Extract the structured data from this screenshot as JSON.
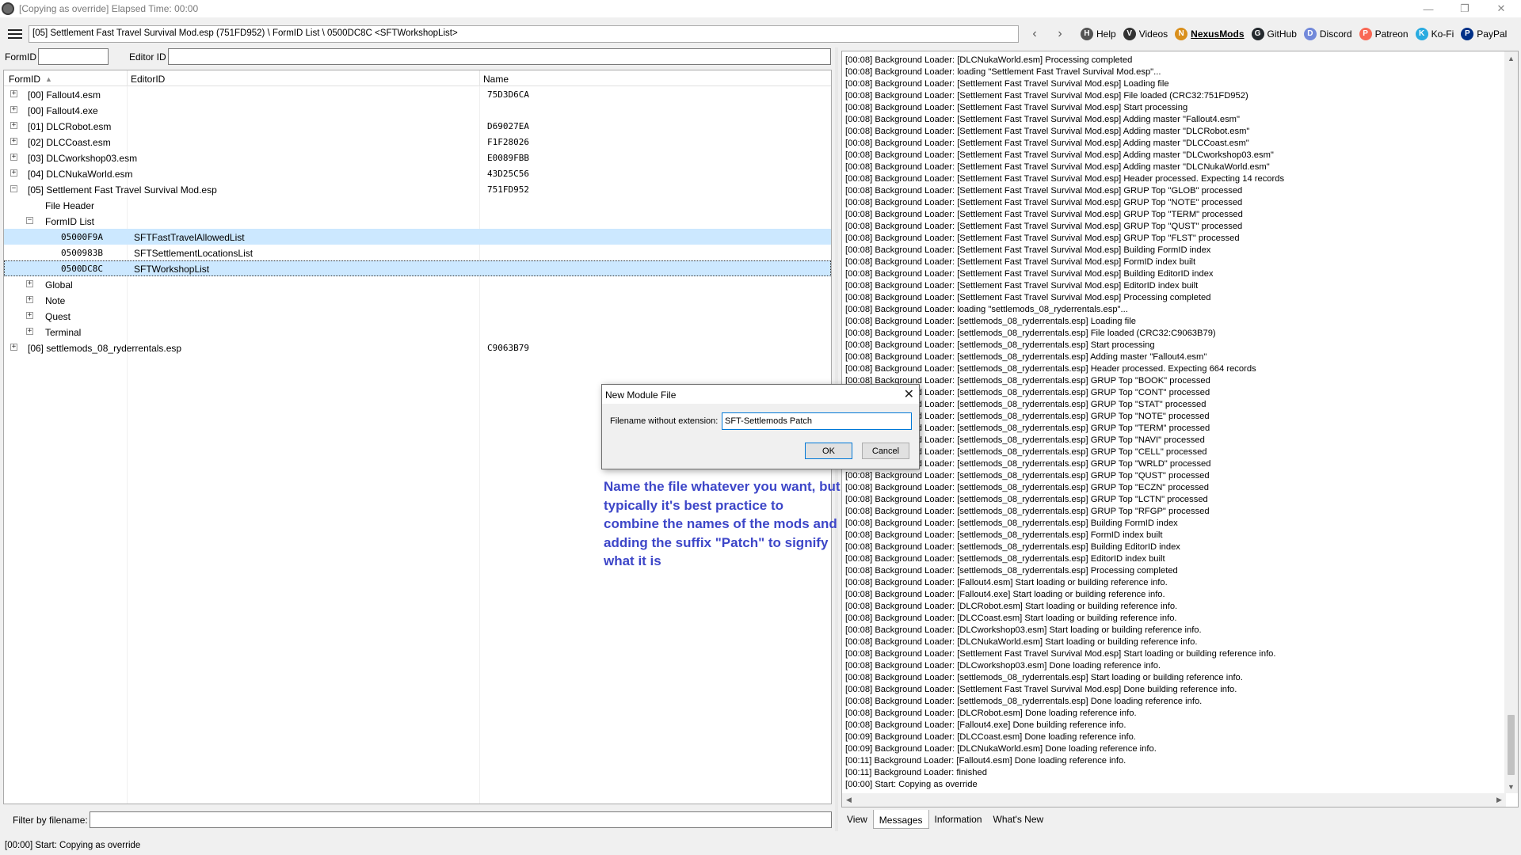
{
  "window": {
    "title": "[Copying as override] Elapsed Time: 00:00",
    "minimize": "—",
    "maximize": "❐",
    "close": "✕"
  },
  "toolbar": {
    "path": "[05] Settlement Fast Travel Survival Mod.esp (751FD952) \\ FormID List \\ 0500DC8C <SFTWorkshopList>",
    "back": "‹",
    "forward": "›",
    "links": [
      {
        "label": "Help",
        "icon": "book-icon",
        "color": "#555555"
      },
      {
        "label": "Videos",
        "icon": "video-icon",
        "color": "#333333"
      },
      {
        "label": "NexusMods",
        "icon": "nexusmods-icon",
        "color": "#d98f1c"
      },
      {
        "label": "GitHub",
        "icon": "github-icon",
        "color": "#24292e"
      },
      {
        "label": "Discord",
        "icon": "discord-icon",
        "color": "#7289da"
      },
      {
        "label": "Patreon",
        "icon": "patreon-icon",
        "color": "#f96854"
      },
      {
        "label": "Ko-Fi",
        "icon": "kofi-icon",
        "color": "#29abe0"
      },
      {
        "label": "PayPal",
        "icon": "paypal-icon",
        "color": "#003087"
      }
    ]
  },
  "filters": {
    "formid_label": "FormID",
    "editorid_label": "Editor ID",
    "filter_by_filename_label": "Filter by filename:"
  },
  "tree": {
    "columns": [
      "FormID",
      "EditorID",
      "Name"
    ],
    "sort_arrow": "▲",
    "rows": [
      {
        "label": "[00] Fallout4.esm",
        "hash": "75D3D6CA",
        "expander": "+"
      },
      {
        "label": "[00] Fallout4.exe",
        "hash": "",
        "expander": "+"
      },
      {
        "label": "[01] DLCRobot.esm",
        "hash": "D69027EA",
        "expander": "+"
      },
      {
        "label": "[02] DLCCoast.esm",
        "hash": "F1F28026",
        "expander": "+"
      },
      {
        "label": "[03] DLCworkshop03.esm",
        "hash": "E0089FBB",
        "expander": "+"
      },
      {
        "label": "[04] DLCNukaWorld.esm",
        "hash": "43D25C56",
        "expander": "+"
      },
      {
        "label": "[05] Settlement Fast Travel Survival Mod.esp",
        "hash": "751FD952",
        "expander": "−"
      },
      {
        "label": "File Header",
        "hash": "",
        "expander": ""
      },
      {
        "label": "FormID List",
        "hash": "",
        "expander": "−"
      },
      {
        "label": "05000F9A",
        "editorid": "SFTFastTravelAllowedList",
        "expander": ""
      },
      {
        "label": "0500983B",
        "editorid": "SFTSettlementLocationsList",
        "expander": ""
      },
      {
        "label": "0500DC8C",
        "editorid": "SFTWorkshopList",
        "expander": ""
      },
      {
        "label": "Global",
        "hash": "",
        "expander": "+"
      },
      {
        "label": "Note",
        "hash": "",
        "expander": "+"
      },
      {
        "label": "Quest",
        "hash": "",
        "expander": "+"
      },
      {
        "label": "Terminal",
        "hash": "",
        "expander": "+"
      },
      {
        "label": "[06] settlemods_08_ryderrentals.esp",
        "hash": "C9063B79",
        "expander": "+"
      }
    ]
  },
  "dialog": {
    "title": "New Module File",
    "close": "✕",
    "field_label": "Filename without extension:",
    "field_value": "SFT-Settlemods Patch",
    "ok": "OK",
    "cancel": "Cancel"
  },
  "annotation": "Name the file whatever you want, but typically it's best practice to combine the names of the mods and adding the suffix \"Patch\" to signify what it is",
  "log": [
    "[00:08] Background Loader: [DLCNukaWorld.esm] Processing completed",
    "[00:08] Background Loader: loading \"Settlement Fast Travel Survival Mod.esp\"...",
    "[00:08] Background Loader: [Settlement Fast Travel Survival Mod.esp] Loading file",
    "[00:08] Background Loader: [Settlement Fast Travel Survival Mod.esp] File loaded (CRC32:751FD952)",
    "[00:08] Background Loader: [Settlement Fast Travel Survival Mod.esp] Start processing",
    "[00:08] Background Loader: [Settlement Fast Travel Survival Mod.esp] Adding master \"Fallout4.esm\"",
    "[00:08] Background Loader: [Settlement Fast Travel Survival Mod.esp] Adding master \"DLCRobot.esm\"",
    "[00:08] Background Loader: [Settlement Fast Travel Survival Mod.esp] Adding master \"DLCCoast.esm\"",
    "[00:08] Background Loader: [Settlement Fast Travel Survival Mod.esp] Adding master \"DLCworkshop03.esm\"",
    "[00:08] Background Loader: [Settlement Fast Travel Survival Mod.esp] Adding master \"DLCNukaWorld.esm\"",
    "[00:08] Background Loader: [Settlement Fast Travel Survival Mod.esp] Header processed. Expecting 14 records",
    "[00:08] Background Loader: [Settlement Fast Travel Survival Mod.esp] GRUP Top \"GLOB\" processed",
    "[00:08] Background Loader: [Settlement Fast Travel Survival Mod.esp] GRUP Top \"NOTE\" processed",
    "[00:08] Background Loader: [Settlement Fast Travel Survival Mod.esp] GRUP Top \"TERM\" processed",
    "[00:08] Background Loader: [Settlement Fast Travel Survival Mod.esp] GRUP Top \"QUST\" processed",
    "[00:08] Background Loader: [Settlement Fast Travel Survival Mod.esp] GRUP Top \"FLST\" processed",
    "[00:08] Background Loader: [Settlement Fast Travel Survival Mod.esp] Building FormID index",
    "[00:08] Background Loader: [Settlement Fast Travel Survival Mod.esp] FormID index built",
    "[00:08] Background Loader: [Settlement Fast Travel Survival Mod.esp] Building EditorID index",
    "[00:08] Background Loader: [Settlement Fast Travel Survival Mod.esp] EditorID index built",
    "[00:08] Background Loader: [Settlement Fast Travel Survival Mod.esp] Processing completed",
    "[00:08] Background Loader: loading \"settlemods_08_ryderrentals.esp\"...",
    "[00:08] Background Loader: [settlemods_08_ryderrentals.esp] Loading file",
    "[00:08] Background Loader: [settlemods_08_ryderrentals.esp] File loaded (CRC32:C9063B79)",
    "[00:08] Background Loader: [settlemods_08_ryderrentals.esp] Start processing",
    "[00:08] Background Loader: [settlemods_08_ryderrentals.esp] Adding master \"Fallout4.esm\"",
    "[00:08] Background Loader: [settlemods_08_ryderrentals.esp] Header processed. Expecting 664 records",
    "[00:08] Background Loader: [settlemods_08_ryderrentals.esp] GRUP Top \"BOOK\" processed",
    "[00:08] Background Loader: [settlemods_08_ryderrentals.esp] GRUP Top \"CONT\" processed",
    "[00:08] Background Loader: [settlemods_08_ryderrentals.esp] GRUP Top \"STAT\" processed",
    "[00:08] Background Loader: [settlemods_08_ryderrentals.esp] GRUP Top \"NOTE\" processed",
    "[00:08] Background Loader: [settlemods_08_ryderrentals.esp] GRUP Top \"TERM\" processed",
    "[00:08] Background Loader: [settlemods_08_ryderrentals.esp] GRUP Top \"NAVI\" processed",
    "[00:08] Background Loader: [settlemods_08_ryderrentals.esp] GRUP Top \"CELL\" processed",
    "[00:08] Background Loader: [settlemods_08_ryderrentals.esp] GRUP Top \"WRLD\" processed",
    "[00:08] Background Loader: [settlemods_08_ryderrentals.esp] GRUP Top \"QUST\" processed",
    "[00:08] Background Loader: [settlemods_08_ryderrentals.esp] GRUP Top \"ECZN\" processed",
    "[00:08] Background Loader: [settlemods_08_ryderrentals.esp] GRUP Top \"LCTN\" processed",
    "[00:08] Background Loader: [settlemods_08_ryderrentals.esp] GRUP Top \"RFGP\" processed",
    "[00:08] Background Loader: [settlemods_08_ryderrentals.esp] Building FormID index",
    "[00:08] Background Loader: [settlemods_08_ryderrentals.esp] FormID index built",
    "[00:08] Background Loader: [settlemods_08_ryderrentals.esp] Building EditorID index",
    "[00:08] Background Loader: [settlemods_08_ryderrentals.esp] EditorID index built",
    "[00:08] Background Loader: [settlemods_08_ryderrentals.esp] Processing completed",
    "[00:08] Background Loader: [Fallout4.esm] Start loading or building reference info.",
    "[00:08] Background Loader: [Fallout4.exe] Start loading or building reference info.",
    "[00:08] Background Loader: [DLCRobot.esm] Start loading or building reference info.",
    "[00:08] Background Loader: [DLCCoast.esm] Start loading or building reference info.",
    "[00:08] Background Loader: [DLCworkshop03.esm] Start loading or building reference info.",
    "[00:08] Background Loader: [DLCNukaWorld.esm] Start loading or building reference info.",
    "[00:08] Background Loader: [Settlement Fast Travel Survival Mod.esp] Start loading or building reference info.",
    "[00:08] Background Loader: [DLCworkshop03.esm] Done loading reference info.",
    "[00:08] Background Loader: [settlemods_08_ryderrentals.esp] Start loading or building reference info.",
    "[00:08] Background Loader: [Settlement Fast Travel Survival Mod.esp] Done building reference info.",
    "[00:08] Background Loader: [settlemods_08_ryderrentals.esp] Done loading reference info.",
    "[00:08] Background Loader: [DLCRobot.esm] Done loading reference info.",
    "[00:08] Background Loader: [Fallout4.exe] Done building reference info.",
    "[00:09] Background Loader: [DLCCoast.esm] Done loading reference info.",
    "[00:09] Background Loader: [DLCNukaWorld.esm] Done loading reference info.",
    "[00:11] Background Loader: [Fallout4.esm] Done loading reference info.",
    "[00:11] Background Loader: finished",
    "[00:00] Start: Copying as override"
  ],
  "tabs": [
    "View",
    "Messages",
    "Information",
    "What's New"
  ],
  "active_tab": "Messages",
  "status": "[00:00] Start: Copying as override"
}
